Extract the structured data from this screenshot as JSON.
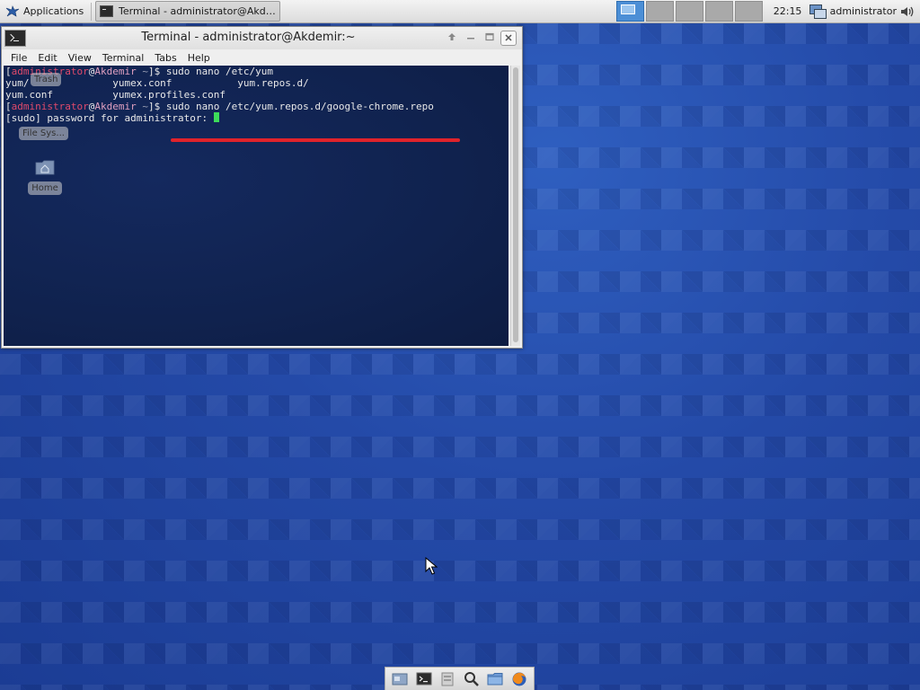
{
  "top_panel": {
    "applications_label": "Applications",
    "taskbar_item_label": "Terminal - administrator@Akdem...",
    "clock": "22:15",
    "user": "administrator",
    "workspace_count": 5,
    "active_workspace": 1
  },
  "desktop": {
    "icons": [
      {
        "label": "Trash"
      },
      {
        "label": "File Sys..."
      },
      {
        "label": "Home"
      }
    ]
  },
  "terminal": {
    "title": "Terminal - administrator@Akdemir:~",
    "menu": [
      "File",
      "Edit",
      "View",
      "Terminal",
      "Tabs",
      "Help"
    ],
    "prompt": {
      "user": "administrator",
      "host": "Akdemir",
      "dir": "~"
    },
    "lines": [
      {
        "type": "command",
        "text": "sudo nano /etc/yum"
      },
      {
        "type": "output",
        "text": "yum/              yumex.conf           yum.repos.d/"
      },
      {
        "type": "output",
        "text": "yum.conf          yumex.profiles.conf"
      },
      {
        "type": "command",
        "text": "sudo nano /etc/yum.repos.d/google-chrome.repo"
      },
      {
        "type": "output",
        "text": "[sudo] password for administrator: "
      }
    ],
    "highlight_color": "#e0232b",
    "cursor_color": "#3ddc5a"
  },
  "dock": {
    "icons": [
      "show-desktop-icon",
      "terminal-icon",
      "file-manager-icon",
      "search-icon",
      "folder-icon",
      "firefox-icon"
    ]
  }
}
